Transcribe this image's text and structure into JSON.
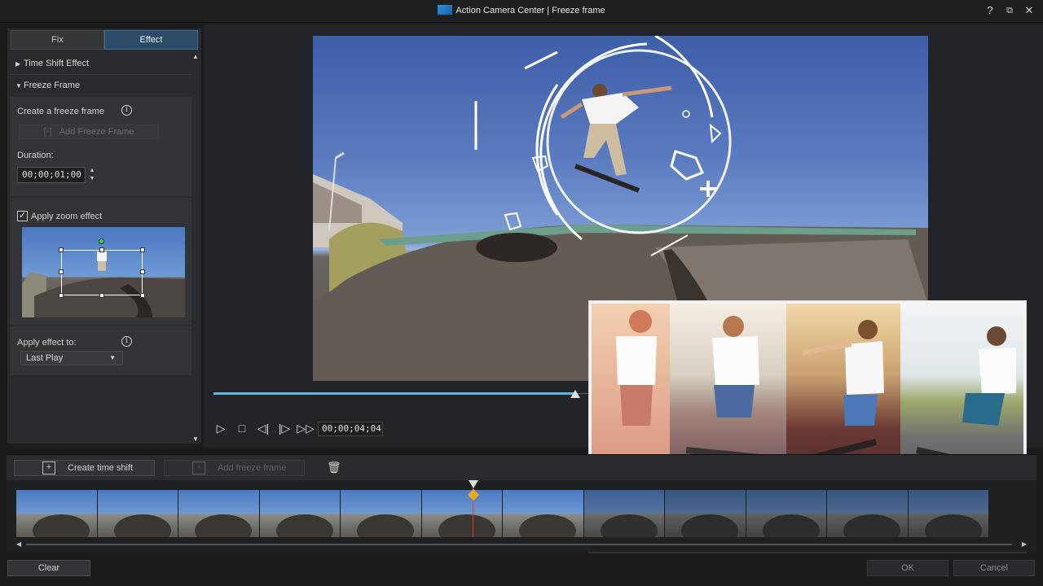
{
  "window": {
    "title": "Action Camera Center  |  Freeze frame",
    "help": "?",
    "restore": "⧉",
    "close": "✕"
  },
  "tabs": [
    {
      "label": "Fix",
      "active": false
    },
    {
      "label": "Effect",
      "active": true
    }
  ],
  "sections": {
    "time_shift": {
      "label": "Time Shift Effect",
      "expanded": false
    },
    "freeze_frame": {
      "label": "Freeze Frame",
      "expanded": true,
      "create_label": "Create a freeze frame",
      "add_button": "Add Freeze Frame",
      "duration_label": "Duration:",
      "duration_value": "00;00;01;00",
      "zoom_checkbox_label": "Apply zoom effect",
      "zoom_checked": true,
      "apply_to_label": "Apply effect to:",
      "apply_to_value": "Last Play"
    }
  },
  "player": {
    "timecode": "00;00;04;04",
    "progress": 0.96
  },
  "toolbar": {
    "create_time_shift": "Create time shift",
    "add_freeze_frame": "Add freeze frame"
  },
  "footer": {
    "clear": "Clear",
    "ok": "OK",
    "cancel": "Cancel"
  },
  "colors": {
    "accent": "#61b2e6",
    "active_tab": "#2d4b66",
    "playhead": "#e03a3a",
    "keyframe": "#f0a81a"
  }
}
